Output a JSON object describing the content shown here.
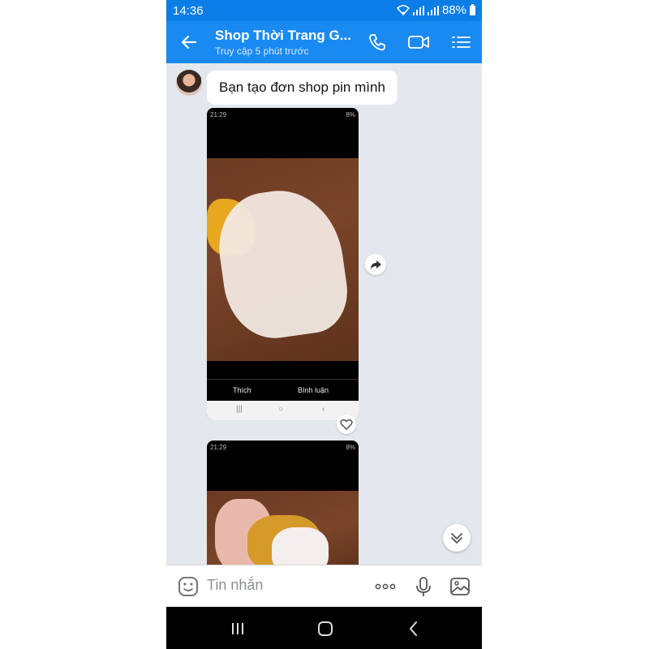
{
  "status_bar": {
    "time": "14:36",
    "battery": "88%",
    "icons": [
      "wifi-icon",
      "signal-icon",
      "signal-icon",
      "battery-icon"
    ]
  },
  "header": {
    "title": "Shop Thời Trang G...",
    "subtitle": "Truy cập 5 phút trước",
    "icons": [
      "back-arrow-icon",
      "phone-icon",
      "video-call-icon",
      "menu-list-icon"
    ],
    "bg_color": "#1a8af3"
  },
  "messages": [
    {
      "type": "text",
      "text": "Bạn tạo đơn shop pin mình"
    },
    {
      "type": "image",
      "screenshot": {
        "time": "21:29",
        "battery": "8%",
        "like_label": "Thích",
        "comment_label": "Bình luận"
      }
    },
    {
      "type": "image",
      "screenshot": {
        "time": "21:29",
        "battery": "8%"
      }
    }
  ],
  "input": {
    "placeholder": "Tin nhắn",
    "icons": [
      "emoji-icon",
      "more-icon",
      "microphone-icon",
      "image-icon"
    ]
  },
  "nav_bar": {
    "icons": [
      "recent-apps-icon",
      "home-icon",
      "back-icon"
    ]
  }
}
